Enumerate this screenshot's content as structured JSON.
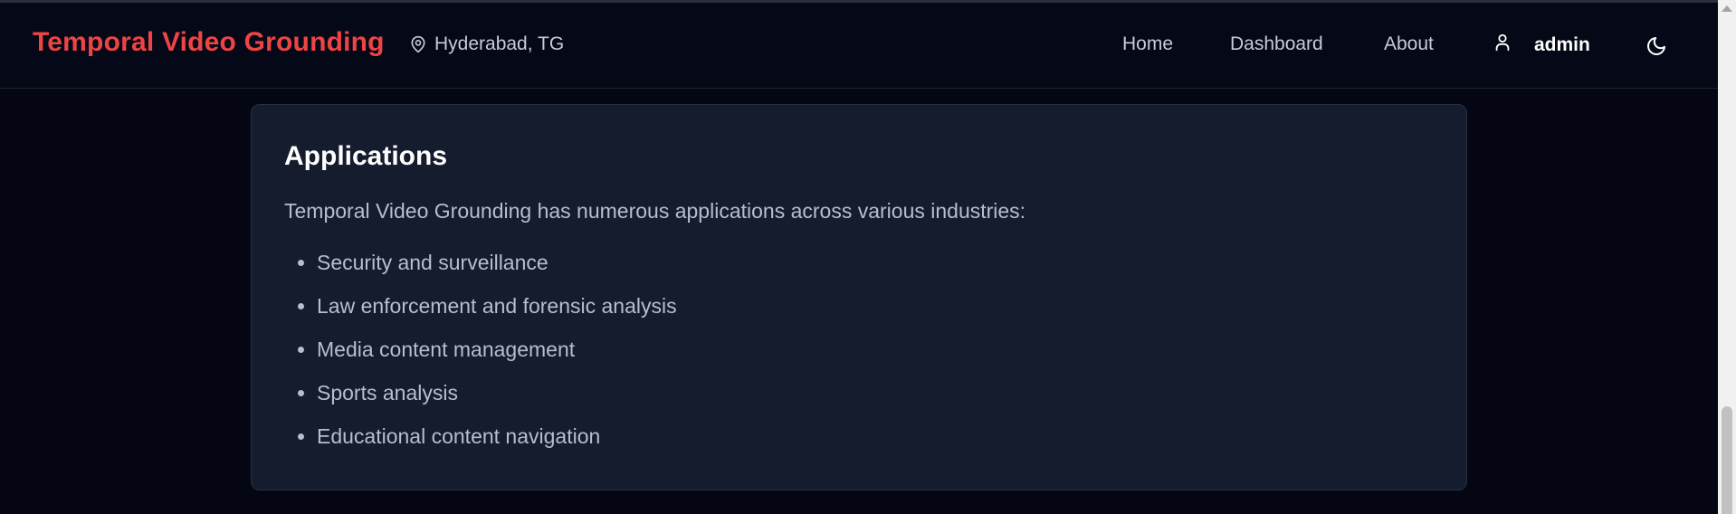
{
  "app": {
    "title": "Temporal Video Grounding",
    "location": "Hyderabad, TG"
  },
  "nav": {
    "home": "Home",
    "dashboard": "Dashboard",
    "about": "About"
  },
  "user": {
    "name": "admin"
  },
  "icons": {
    "location": "map-pin-icon",
    "user": "user-icon",
    "theme": "moon-icon"
  },
  "colors": {
    "brand": "#ef4444",
    "page_bg": "#040713",
    "card_bg": "#141c2d",
    "text_muted": "#b7bfcc"
  },
  "applications": {
    "heading": "Applications",
    "intro": "Temporal Video Grounding has numerous applications across various industries:",
    "items": [
      "Security and surveillance",
      "Law enforcement and forensic analysis",
      "Media content management",
      "Sports analysis",
      "Educational content navigation"
    ]
  }
}
